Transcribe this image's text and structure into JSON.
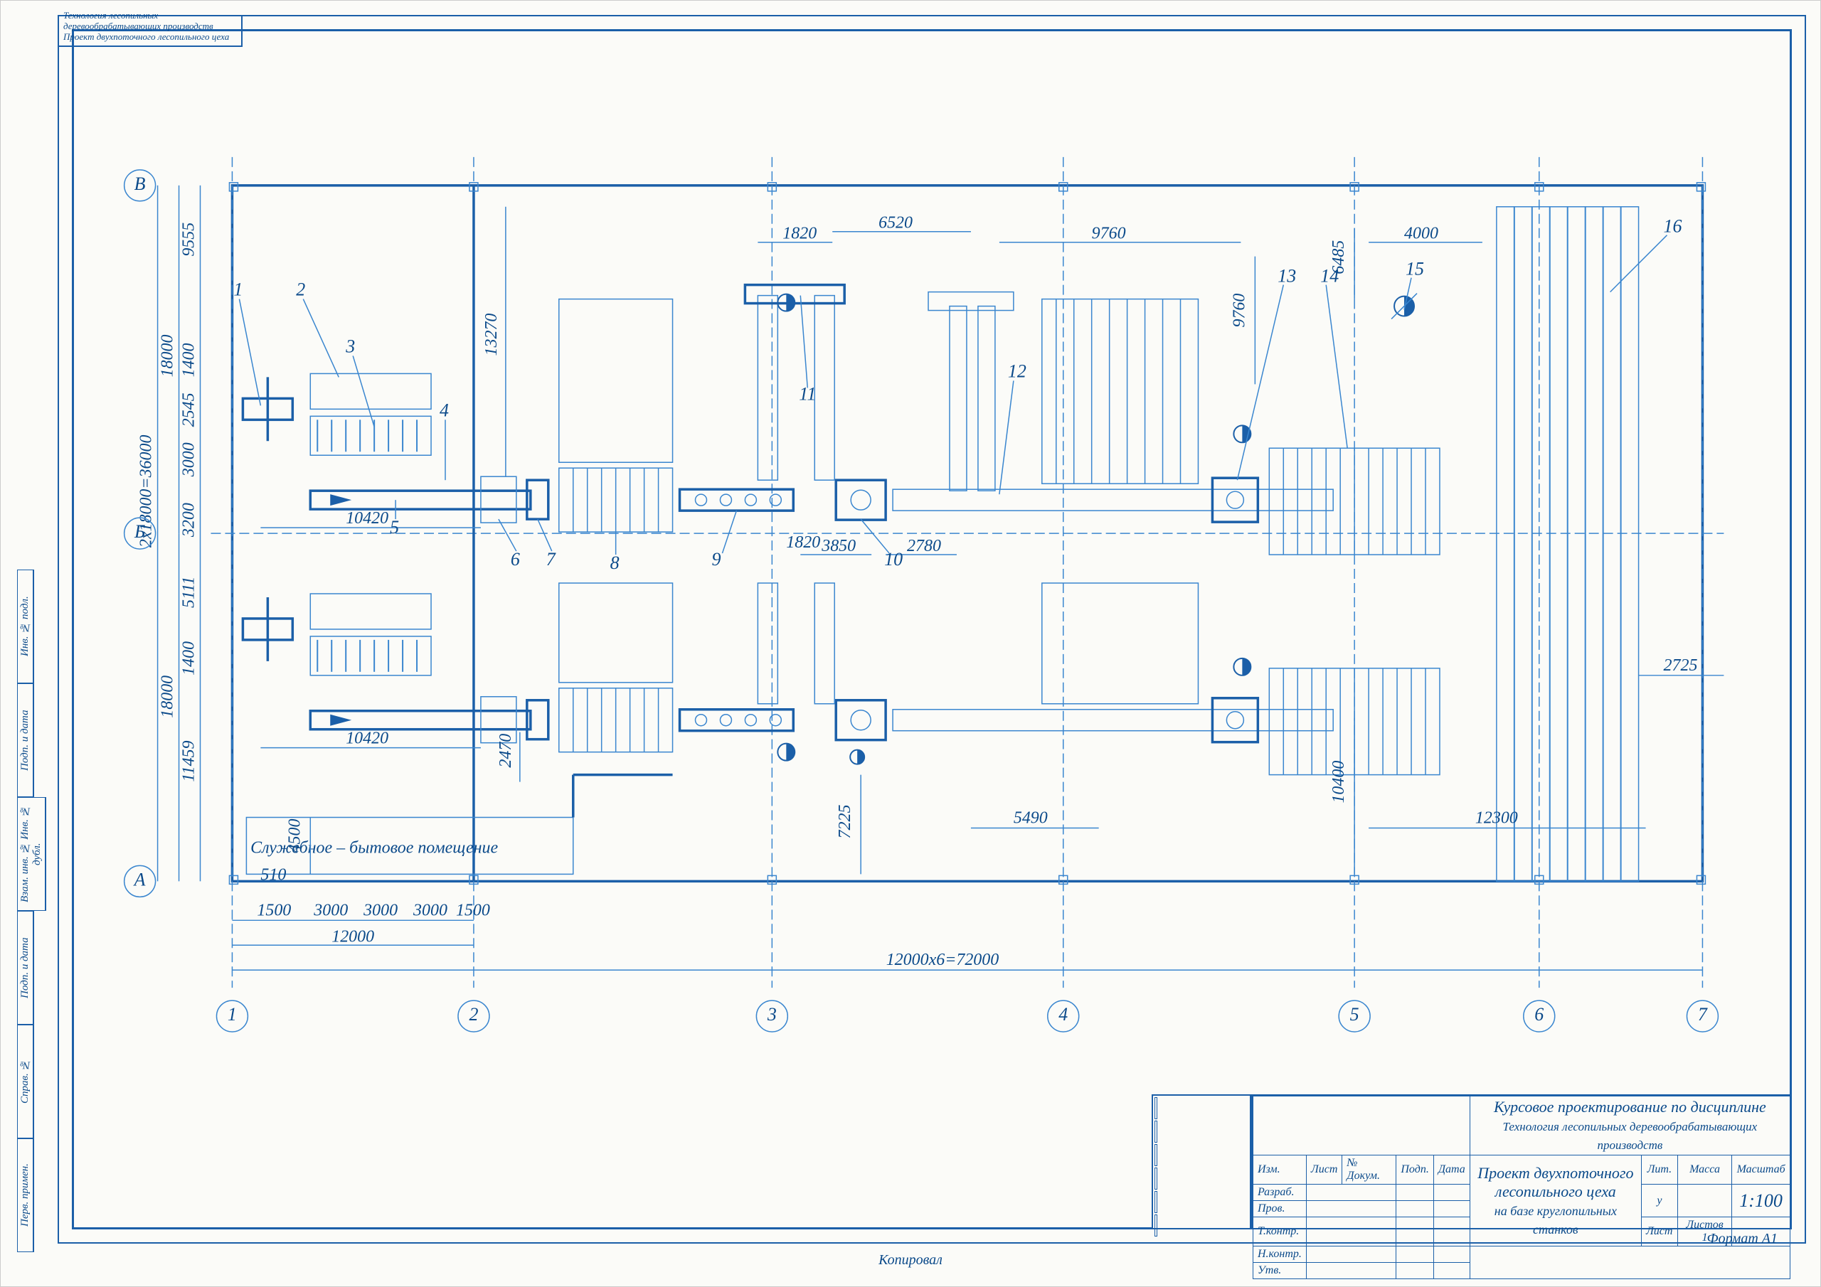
{
  "grid": {
    "rows": [
      "А",
      "Б",
      "В"
    ],
    "cols": [
      "1",
      "2",
      "3",
      "4",
      "5",
      "6",
      "7"
    ]
  },
  "callouts": [
    "1",
    "2",
    "3",
    "4",
    "5",
    "6",
    "7",
    "8",
    "9",
    "10",
    "11",
    "12",
    "13",
    "14",
    "15",
    "16"
  ],
  "dimensions": {
    "top": {
      "d1820": "1820",
      "d6520": "6520",
      "d9760": "9760",
      "d9760b": "9760",
      "d6485": "6485",
      "d4000": "4000"
    },
    "mid": {
      "d1820b": "1820",
      "d3850": "3850",
      "d2780": "2780",
      "d10420a": "10420",
      "d10420b": "10420",
      "d2470": "2470"
    },
    "bottom": {
      "d7225": "7225",
      "d5490": "5490",
      "d12300": "12300",
      "d510": "510",
      "d4500": "4500",
      "d10400": "10400"
    },
    "baygrid": {
      "d1500a": "1500",
      "d3000a": "3000",
      "d3000b": "3000",
      "d3000c": "3000",
      "d1500b": "1500",
      "d12000": "12000",
      "d_total": "12000x6=72000"
    },
    "left": {
      "overall": "2x18000=36000",
      "d18000a": "18000",
      "d18000b": "18000",
      "d11459": "11459",
      "d1400a": "1400",
      "d5111": "5111",
      "d3200": "3200",
      "d13270": "13270",
      "d3000": "3000",
      "d2545": "2545",
      "d1400b": "1400",
      "d9555": "9555"
    },
    "right": {
      "d2725": "2725"
    }
  },
  "room_label": "Служебное – бытовое помещение",
  "title_block": {
    "line1": "Курсовое проектирование по дисциплине",
    "line2": "Технология лесопильных деревообрабатывающих производств",
    "main1": "Проект двухпоточного",
    "main2": "лесопильного цеха",
    "main3": "на базе круглопильных станков",
    "scale_label": "Масштаб",
    "scale": "1:100",
    "lit": "Лит.",
    "mass": "Масса",
    "izm": "Изм.",
    "list_no": "Лист",
    "ndokum": "№ Докум.",
    "podp": "Подп.",
    "data": "Дата",
    "razrab": "Разраб.",
    "prov": "Пров.",
    "tkontr": "Т.контр.",
    "nkontr": "Н.контр.",
    "utv": "Утв.",
    "list": "Лист",
    "listov": "Листов",
    "listov_val": "1",
    "lit_val": "у"
  },
  "upper_note": {
    "l1": "Технология лесопильных деревообрабатывающих производств",
    "l2": "Проект двухпоточного лесопильного цеха"
  },
  "side_labels": [
    "Инв. № подл.",
    "Подп. и дата",
    "Взам. инв. № Инв. № дубл.",
    "Подп. и дата",
    "Справ. №",
    "Перв. примен."
  ],
  "footer": "Копировал",
  "format": "Формат  А1"
}
